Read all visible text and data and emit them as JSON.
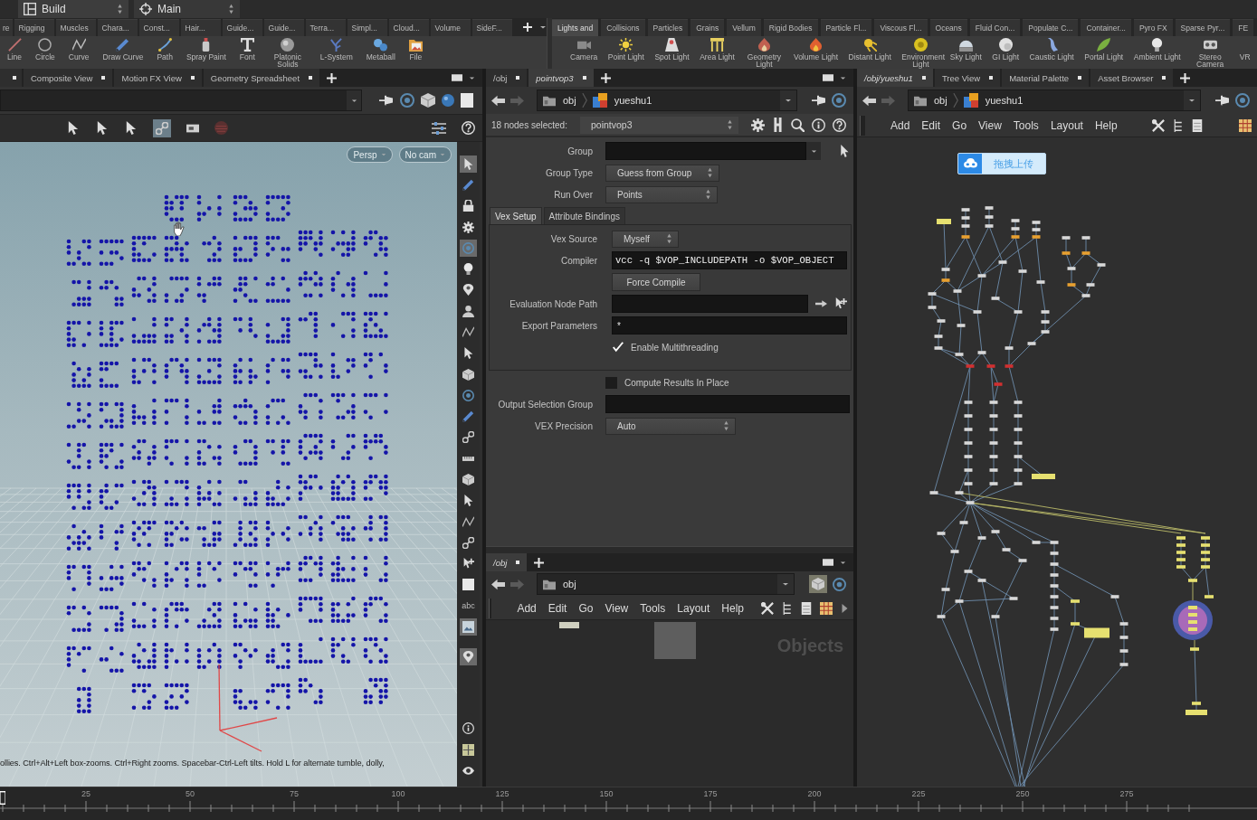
{
  "desk_bar": {
    "desk": "Build",
    "desktop": "Main"
  },
  "shelf_left": {
    "tabs": [
      {
        "label": "re",
        "selected": false
      },
      {
        "label": "Rigging",
        "selected": false
      },
      {
        "label": "Muscles",
        "selected": false
      },
      {
        "label": "Chara...",
        "selected": false
      },
      {
        "label": "Const...",
        "selected": false
      },
      {
        "label": "Hair...",
        "selected": false
      },
      {
        "label": "Guide...",
        "selected": false
      },
      {
        "label": "Guide...",
        "selected": false
      },
      {
        "label": "Terra...",
        "selected": false
      },
      {
        "label": "Simpl...",
        "selected": false
      },
      {
        "label": "Cloud...",
        "selected": false
      },
      {
        "label": "Volume",
        "selected": false
      },
      {
        "label": "SideF...",
        "selected": false
      }
    ],
    "tools": [
      {
        "label": "Line"
      },
      {
        "label": "Circle"
      },
      {
        "label": "Curve"
      },
      {
        "label": "Draw Curve"
      },
      {
        "label": "Path"
      },
      {
        "label": "Spray Paint"
      },
      {
        "label": "Font"
      },
      {
        "label": "Platonic Solids"
      },
      {
        "label": "L-System"
      },
      {
        "label": "Metaball"
      },
      {
        "label": "File"
      }
    ]
  },
  "shelf_right": {
    "tabs": [
      {
        "label": "Lights and",
        "selected": true
      },
      {
        "label": "Collisions",
        "selected": false
      },
      {
        "label": "Particles",
        "selected": false
      },
      {
        "label": "Grains",
        "selected": false
      },
      {
        "label": "Vellum",
        "selected": false
      },
      {
        "label": "Rigid Bodies",
        "selected": false
      },
      {
        "label": "Particle Fl...",
        "selected": false
      },
      {
        "label": "Viscous Fl...",
        "selected": false
      },
      {
        "label": "Oceans",
        "selected": false
      },
      {
        "label": "Fluid Con...",
        "selected": false
      },
      {
        "label": "Populate C...",
        "selected": false
      },
      {
        "label": "Container...",
        "selected": false
      },
      {
        "label": "Pyro FX",
        "selected": false
      },
      {
        "label": "Sparse Pyr...",
        "selected": false
      },
      {
        "label": "FE",
        "selected": false
      }
    ],
    "tools": [
      {
        "label": "Camera"
      },
      {
        "label": "Point Light"
      },
      {
        "label": "Spot Light"
      },
      {
        "label": "Area Light"
      },
      {
        "label": "Geometry Light"
      },
      {
        "label": "Volume Light"
      },
      {
        "label": "Distant Light"
      },
      {
        "label": "Environment Light"
      },
      {
        "label": "Sky Light"
      },
      {
        "label": "GI Light"
      },
      {
        "label": "Caustic Light"
      },
      {
        "label": "Portal Light"
      },
      {
        "label": "Ambient Light"
      },
      {
        "label": "Stereo Camera"
      },
      {
        "label": "VR"
      }
    ]
  },
  "scene_view": {
    "tabs": [
      {
        "label": "Composite View",
        "selected": false
      },
      {
        "label": "Motion FX View",
        "selected": false
      },
      {
        "label": "Geometry Spreadsheet",
        "selected": false
      }
    ],
    "view_buttons": [
      "Persp",
      "No cam"
    ],
    "toolbar_text": "abc",
    "hint": "ollies. Ctrl+Alt+Left box-zooms. Ctrl+Right zooms. Spacebar-Ctrl-Left tilts. Hold L for alternate tumble, dolly,"
  },
  "parameters_pane": {
    "tabs": [
      {
        "label": "/obj",
        "selected": false
      },
      {
        "label": "pointvop3",
        "selected": true
      }
    ],
    "path": [
      "obj",
      "yueshu1"
    ],
    "selection": "18 nodes selected:",
    "node": "pointvop3",
    "parameters": [
      {
        "kind": "group_field",
        "label": "Group"
      },
      {
        "kind": "menu",
        "label": "Group Type",
        "value": "Guess from Group"
      },
      {
        "kind": "menu",
        "label": "Run Over",
        "value": "Points"
      }
    ],
    "folders": [
      {
        "label": "Vex Setup",
        "selected": true
      },
      {
        "label": "Attribute Bindings",
        "selected": false
      }
    ],
    "folder_parameters": [
      {
        "kind": "menu",
        "label": "Vex Source",
        "value": "Myself"
      },
      {
        "kind": "code_field",
        "label": "Compiler",
        "value": "vcc -q $VOP_INCLUDEPATH -o $VOP_OBJECT"
      },
      {
        "kind": "button",
        "label": "Force Compile"
      },
      {
        "kind": "node_field",
        "label": "Evaluation Node Path"
      },
      {
        "kind": "field",
        "label": "Export Parameters",
        "value": "*"
      },
      {
        "kind": "toggle",
        "label": "Enable Multithreading",
        "checked": true
      }
    ],
    "more_parameters": [
      {
        "kind": "toggle",
        "label": "Compute Results In Place",
        "checked": false
      },
      {
        "kind": "field",
        "label": "Output Selection Group"
      },
      {
        "kind": "menu",
        "label": "VEX Precision",
        "value": "Auto"
      }
    ]
  },
  "object_network": {
    "tabs": [
      {
        "label": "/obj",
        "selected": true
      }
    ],
    "path": [
      "obj"
    ],
    "menu": [
      "Add",
      "Edit",
      "Go",
      "View",
      "Tools",
      "Layout",
      "Help"
    ],
    "context_label": "Objects"
  },
  "geometry_network": {
    "tabs": [
      {
        "label": "/obj/yueshu1",
        "selected": true
      },
      {
        "label": "Tree View",
        "selected": false
      },
      {
        "label": "Material Palette",
        "selected": false
      },
      {
        "label": "Asset Browser",
        "selected": false
      }
    ],
    "path": [
      "obj",
      "yueshu1"
    ],
    "menu": [
      "Add",
      "Edit",
      "Go",
      "View",
      "Tools",
      "Layout",
      "Help"
    ],
    "upload_button": "拖拽上传"
  },
  "timeline": {
    "frames": [
      "25",
      "50",
      "75",
      "100",
      "125",
      "150",
      "175",
      "200",
      "225",
      "250",
      "275"
    ]
  }
}
